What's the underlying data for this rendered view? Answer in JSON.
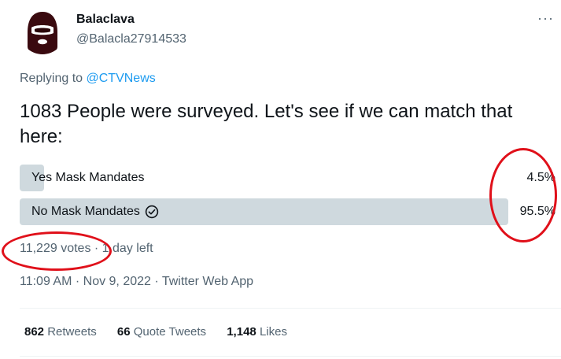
{
  "author": {
    "name": "Balaclava",
    "handle": "@Balacla27914533"
  },
  "icons": {
    "avatar": "balaclava-avatar-icon",
    "more": "more-icon",
    "check": "check-circle-icon"
  },
  "more_label": "···",
  "reply": {
    "prefix": "Replying to",
    "mention": "@CTVNews"
  },
  "tweet_text": "1083 People were surveyed. Let's see if we can match that here:",
  "poll": {
    "options": [
      {
        "label": "Yes Mask Mandates",
        "percent": "4.5%",
        "fraction": 0.045
      },
      {
        "label": "No Mask Mandates",
        "percent": "95.5%",
        "fraction": 0.955,
        "selected": true
      }
    ],
    "votes": "11,229 votes",
    "separator": "·",
    "time_left": "1 day left"
  },
  "timestamp": "11:09 AM · Nov 9, 2022 · Twitter Web App",
  "stats": {
    "retweets_count": "862",
    "retweets_label": "Retweets",
    "quotes_count": "66",
    "quotes_label": "Quote Tweets",
    "likes_count": "1,148",
    "likes_label": "Likes"
  },
  "colors": {
    "annotation": "#e0101a",
    "link": "#1d9bf0",
    "poll_bar": "#cfd9de",
    "secondary_text": "#536471"
  }
}
